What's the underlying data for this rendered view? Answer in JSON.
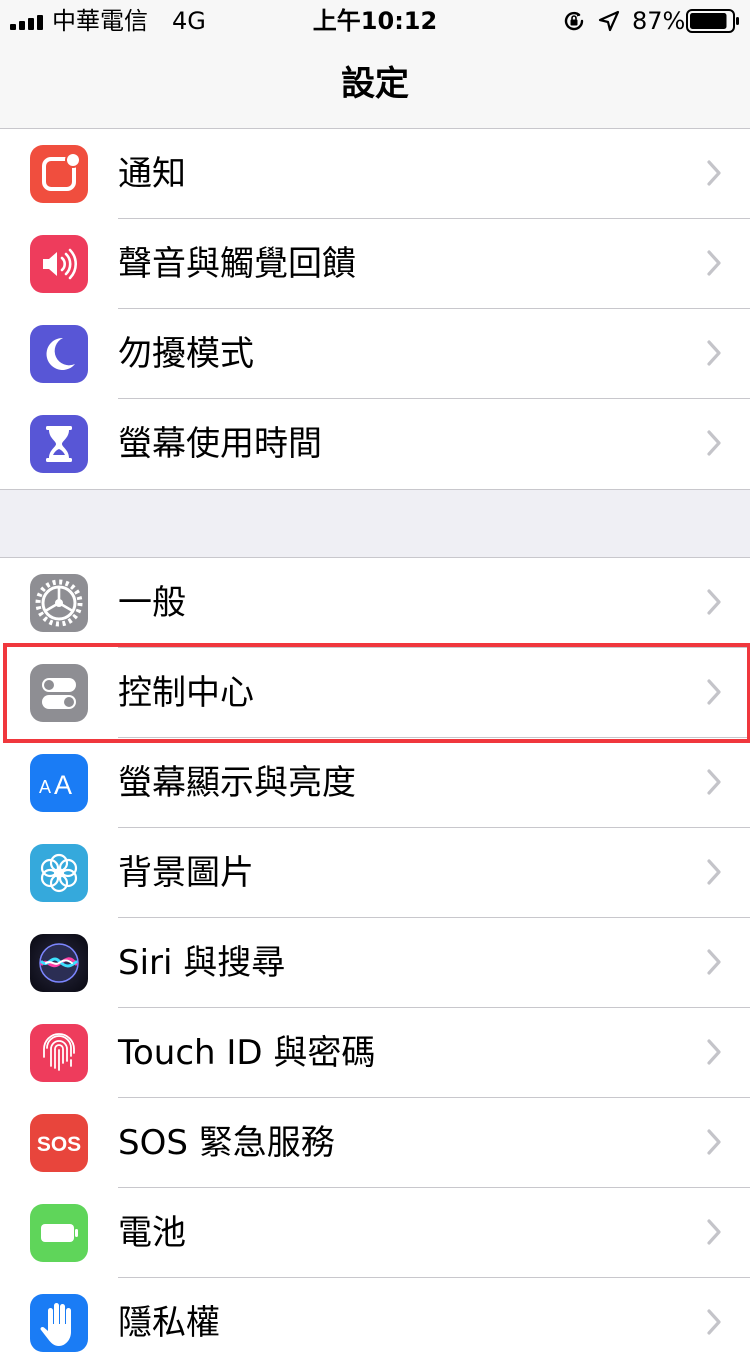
{
  "status_bar": {
    "carrier": "中華電信",
    "network": "4G",
    "time": "上午10:12",
    "battery_percent": "87%",
    "battery_level": 0.87,
    "signal_bars": 4
  },
  "nav": {
    "title": "設定"
  },
  "groups": [
    {
      "items": [
        {
          "label": "通知",
          "icon": "notifications-icon",
          "color": "#f04e3e"
        },
        {
          "label": "聲音與觸覺回饋",
          "icon": "speaker-icon",
          "color": "#ee3c5c"
        },
        {
          "label": "勿擾模式",
          "icon": "moon-icon",
          "color": "#5856d6"
        },
        {
          "label": "螢幕使用時間",
          "icon": "hourglass-icon",
          "color": "#5856d6"
        }
      ]
    },
    {
      "items": [
        {
          "label": "一般",
          "icon": "gear-icon",
          "color": "#8e8e93"
        },
        {
          "label": "控制中心",
          "icon": "toggles-icon",
          "color": "#8e8e93"
        },
        {
          "label": "螢幕顯示與亮度",
          "icon": "text-size-icon",
          "color": "#1a7cf5"
        },
        {
          "label": "背景圖片",
          "icon": "flower-icon",
          "color": "#35a9dc"
        },
        {
          "label": "Siri 與搜尋",
          "icon": "siri-icon",
          "color": "#1c1c2e"
        },
        {
          "label": "Touch ID 與密碼",
          "icon": "fingerprint-icon",
          "color": "#ee3c5c"
        },
        {
          "label": "SOS 緊急服務",
          "icon": "sos-icon",
          "color": "#e8453c",
          "icon_text": "SOS"
        },
        {
          "label": "電池",
          "icon": "battery-icon",
          "color": "#5fd55a"
        },
        {
          "label": "隱私權",
          "icon": "hand-icon",
          "color": "#1a7cf5"
        }
      ]
    }
  ],
  "highlight_color": "#f0373d"
}
